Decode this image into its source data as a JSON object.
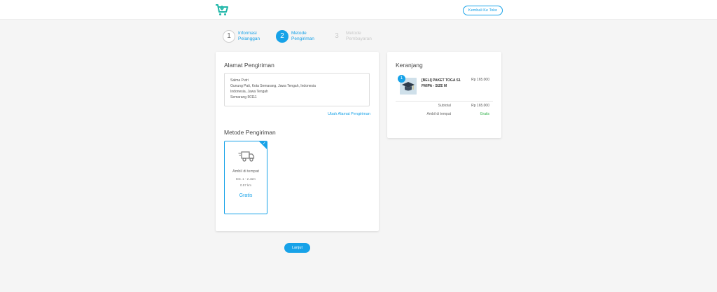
{
  "header": {
    "logo_icon": "shopping-cart-icon",
    "back_button_label": "Kembali Ke Toko",
    "accent_color": "#17a2e8"
  },
  "steps": [
    {
      "number": "1",
      "label_line1": "Informasi",
      "label_line2": "Pelanggan",
      "state": "done"
    },
    {
      "number": "2",
      "label_line1": "Metode",
      "label_line2": "Pengiriman",
      "state": "active"
    },
    {
      "number": "3",
      "label_line1": "Metode",
      "label_line2": "Pembayaran",
      "state": "todo"
    }
  ],
  "shipping_address": {
    "title": "Alamat Pengiriman",
    "lines": [
      "Salma Putri",
      "Gunung Pati, Kota Semarang, Jawa Tengah, Indonesia",
      "Indonesia, Jawa Tengah",
      "Semarang 50111"
    ],
    "edit_link": "Ubah Alamat Pengiriman"
  },
  "shipping_method": {
    "title": "Metode Pengiriman",
    "option": {
      "icon": "truck-icon",
      "name": "Ambil di tempat",
      "estimate": "Est. 1 - 2 Jam",
      "distance": "0.57 km",
      "price": "Gratis",
      "selected": true
    }
  },
  "cart": {
    "title": "Keranjang",
    "item": {
      "quantity": "1",
      "name": "[BELI] PAKET TOGA S1 FMIPA - SIZE M",
      "price": "Rp 165.000"
    },
    "subtotal_label": "Subtotal",
    "subtotal_value": "Rp 165.000",
    "shipping_label": "Ambil di tempat",
    "shipping_value": "Gratis"
  },
  "footer": {
    "next_button_label": "Lanjut"
  }
}
